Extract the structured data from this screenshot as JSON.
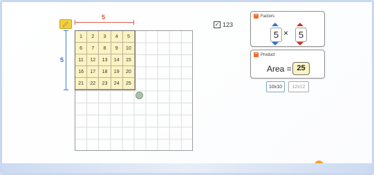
{
  "width_value": "5",
  "height_value": "5",
  "number_toggle": {
    "checked": true,
    "label": "123"
  },
  "cell_numbers": [
    "1",
    "2",
    "3",
    "4",
    "5",
    "6",
    "7",
    "8",
    "9",
    "10",
    "11",
    "12",
    "13",
    "14",
    "15",
    "16",
    "17",
    "18",
    "19",
    "20",
    "21",
    "22",
    "23",
    "24",
    "25"
  ],
  "factors_panel": {
    "title": "Factors",
    "left_value": "5",
    "times": "×",
    "right_value": "5",
    "accent_left": "#2f73cd",
    "accent_right": "#c0392b"
  },
  "product_panel": {
    "title": "Product",
    "label": "Area =",
    "value": "25"
  },
  "grid_buttons": {
    "option_a": "10x10",
    "option_b": "12x12"
  },
  "icons": {
    "pencil": "pencil-icon",
    "reset": "reset-icon",
    "collapse": "minus-icon"
  },
  "colors": {
    "highlight": "#fbf3c2",
    "accent": "#ef6c2e"
  }
}
